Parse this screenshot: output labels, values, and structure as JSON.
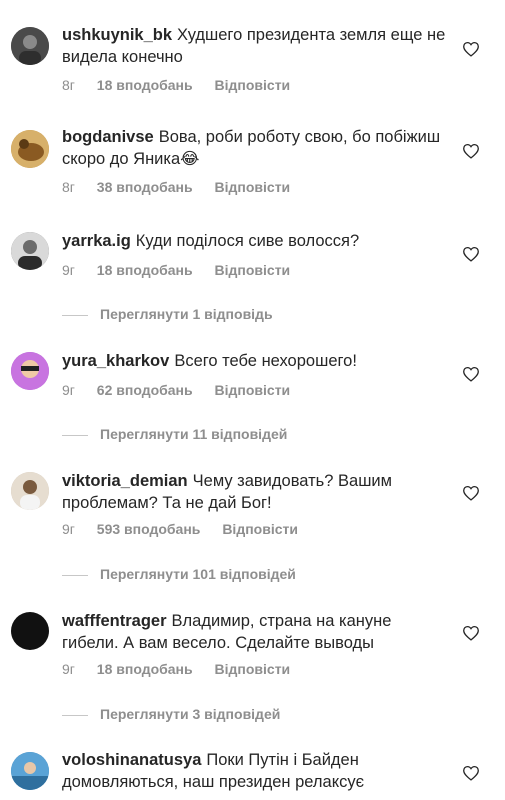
{
  "comments": [
    {
      "username": "ushkuynik_bk",
      "text": "Худшего президента земля еще не видела конечно",
      "time": "8г",
      "likes": "18 вподобань",
      "reply": "Відповісти",
      "avatar_color": "#5a5a5a"
    },
    {
      "username": "bogdanivse",
      "text": "Вова, роби роботу свою, бо побіжиш  скоро до Яника😂",
      "time": "8г",
      "likes": "38 вподобань",
      "reply": "Відповісти",
      "avatar_color": "#b8862c"
    },
    {
      "username": "yarrka.ig",
      "text": "Куди поділося сиве волосся?",
      "time": "9г",
      "likes": "18 вподобань",
      "reply": "Відповісти",
      "avatar_color": "#6b6b6b",
      "view_replies": "Переглянути 1 відповідь"
    },
    {
      "username": "yura_kharkov",
      "text": "Всего тебе нехорошего!",
      "time": "9г",
      "likes": "62 вподобань",
      "reply": "Відповісти",
      "avatar_color": "#a15ac7",
      "view_replies": "Переглянути 11 відповідей"
    },
    {
      "username": "viktoria_demian",
      "text": "Чему завидовать? Вашим проблемам? Та не дай Бог!",
      "time": "9г",
      "likes": "593 вподобань",
      "reply": "Відповісти",
      "avatar_color": "#c8b9a6",
      "view_replies": "Переглянути 101 відповідей"
    },
    {
      "username": "wafffentrager",
      "text": "Владимир, страна на кануне гибели. А вам весело. Сделайте выводы",
      "time": "9г",
      "likes": "18 вподобань",
      "reply": "Відповісти",
      "avatar_color": "#111111",
      "view_replies": "Переглянути 3 відповідей"
    },
    {
      "username": "voloshinanatusya",
      "text": "Поки Путін і Байден домовляються, наш президен релаксує",
      "avatar_color": "#3a79a8"
    }
  ]
}
